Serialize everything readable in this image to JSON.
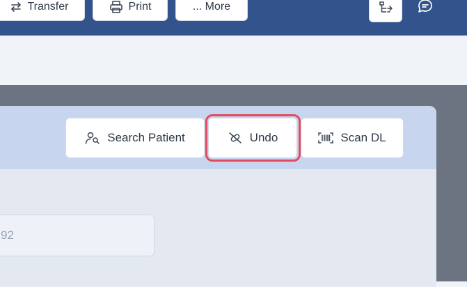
{
  "toolbar": {
    "transfer_label": "Transfer",
    "print_label": "Print",
    "more_label": "... More"
  },
  "panel": {
    "search_patient_label": "Search Patient",
    "undo_label": "Undo",
    "scan_dl_label": "Scan DL"
  },
  "form": {
    "partial_field_value": "92"
  },
  "colors": {
    "topbar": "#33538c",
    "panel_header": "#c7d6ee",
    "highlight": "#e34a5d"
  }
}
